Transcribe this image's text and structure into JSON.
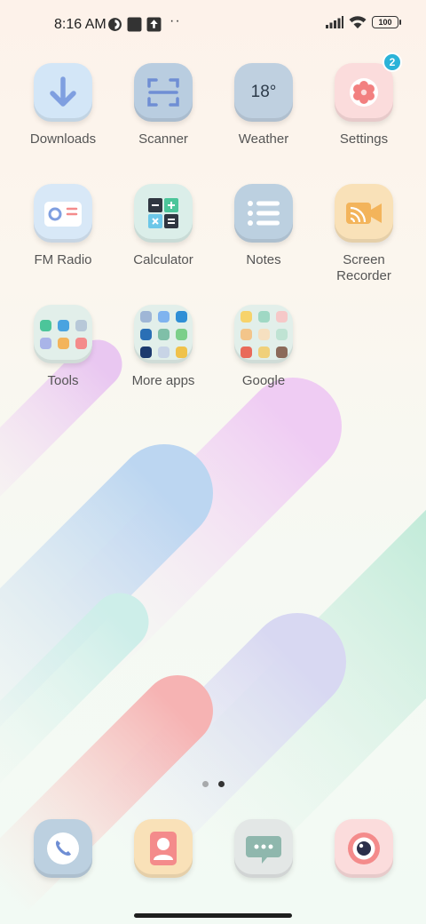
{
  "status_bar": {
    "time": "8:16 AM",
    "battery": "100",
    "icons": [
      "notification-app-icon",
      "square-icon",
      "upload-icon",
      "more-dots-icon",
      "signal-icon",
      "wifi-icon",
      "battery-icon"
    ],
    "more": "··"
  },
  "apps": [
    {
      "label": "Downloads",
      "icon": "download-arrow-icon",
      "color": "#d3e6f7"
    },
    {
      "label": "Scanner",
      "icon": "scanner-icon",
      "color": "#b9cde0"
    },
    {
      "label": "Weather",
      "icon": "weather-icon",
      "text": "18°",
      "color": "#bfd0e0"
    },
    {
      "label": "Settings",
      "icon": "gear-icon",
      "badge": "2",
      "color": "#fbdcdc"
    },
    {
      "label": "FM Radio",
      "icon": "radio-icon",
      "color": "#d8e8f7"
    },
    {
      "label": "Calculator",
      "icon": "calculator-icon",
      "color": "#dbeee9"
    },
    {
      "label": "Notes",
      "icon": "list-icon",
      "color": "#bcd0e0"
    },
    {
      "label": "Screen Recorder",
      "label_line1": "Screen",
      "label_line2": "Recorder",
      "icon": "video-camera-icon",
      "color": "#f9e1b8"
    }
  ],
  "folders": [
    {
      "label": "Tools"
    },
    {
      "label": "More apps"
    },
    {
      "label": "Google"
    }
  ],
  "pager": {
    "pages": 2,
    "active_index": 1
  },
  "dock": [
    {
      "name": "phone",
      "icon": "phone-icon",
      "color": "#bcd0e0"
    },
    {
      "name": "contacts",
      "icon": "contact-icon",
      "color": "#f9e1b8"
    },
    {
      "name": "messages",
      "icon": "message-icon",
      "color": "#e3e7e6"
    },
    {
      "name": "camera",
      "icon": "camera-icon",
      "color": "#fbdcdc"
    }
  ]
}
